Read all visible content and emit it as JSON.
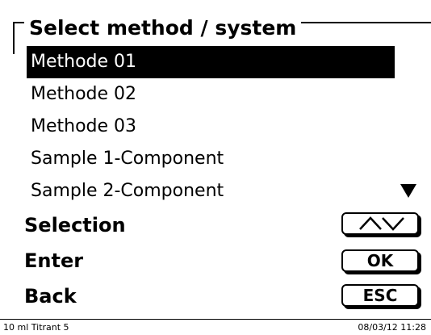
{
  "dialog": {
    "title": "Select method / system",
    "items": [
      {
        "label": "Methode 01",
        "selected": true
      },
      {
        "label": "Methode 02",
        "selected": false
      },
      {
        "label": "Methode 03",
        "selected": false
      },
      {
        "label": "Sample 1-Component",
        "selected": false
      },
      {
        "label": "Sample 2-Component",
        "selected": false
      }
    ],
    "scroll_indicator": "down-triangle-icon"
  },
  "controls": {
    "selection_label": "Selection",
    "selection_key_icon": "up-down-arrows-icon",
    "enter_label": "Enter",
    "enter_key": "OK",
    "back_label": "Back",
    "back_key": "ESC"
  },
  "status_bar": {
    "left": "10 ml Titrant 5",
    "right": "08/03/12 11:28"
  }
}
